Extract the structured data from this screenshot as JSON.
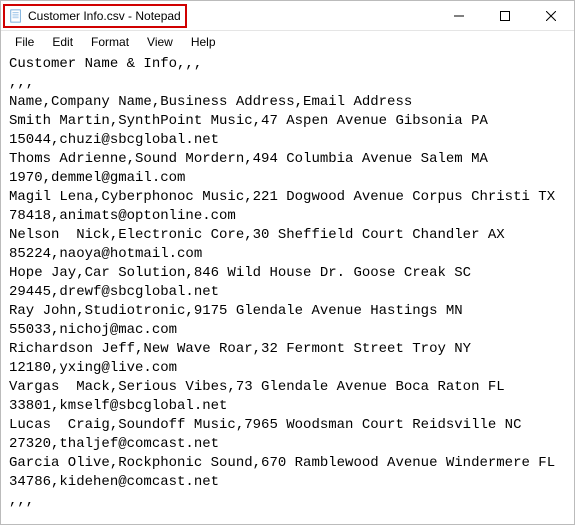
{
  "window": {
    "title": "Customer Info.csv - Notepad"
  },
  "menubar": {
    "file": "File",
    "edit": "Edit",
    "format": "Format",
    "view": "View",
    "help": "Help"
  },
  "lines": [
    "Customer Name & Info,,,",
    ",,,",
    "Name,Company Name,Business Address,Email Address",
    "Smith Martin,SynthPoint Music,47 Aspen Avenue Gibsonia PA",
    "15044,chuzi@sbcglobal.net",
    "Thoms Adrienne,Sound Mordern,494 Columbia Avenue Salem MA",
    "1970,demmel@gmail.com",
    "Magil Lena,Cyberphonoc Music,221 Dogwood Avenue Corpus Christi TX",
    "78418,animats@optonline.com",
    "Nelson  Nick,Electronic Core,30 Sheffield Court Chandler AX",
    "85224,naoya@hotmail.com",
    "Hope Jay,Car Solution,846 Wild House Dr. Goose Creak SC",
    "29445,drewf@sbcglobal.net",
    "Ray John,Studiotronic,9175 Glendale Avenue Hastings MN",
    "55033,nichoj@mac.com",
    "Richardson Jeff,New Wave Roar,32 Fermont Street Troy NY",
    "12180,yxing@live.com",
    "Vargas  Mack,Serious Vibes,73 Glendale Avenue Boca Raton FL",
    "33801,kmself@sbcglobal.net",
    "Lucas  Craig,Soundoff Music,7965 Woodsman Court Reidsville NC",
    "27320,thaljef@comcast.net",
    "Garcia Olive,Rockphonic Sound,670 Ramblewood Avenue Windermere FL",
    "34786,kidehen@comcast.net",
    ",,,"
  ]
}
